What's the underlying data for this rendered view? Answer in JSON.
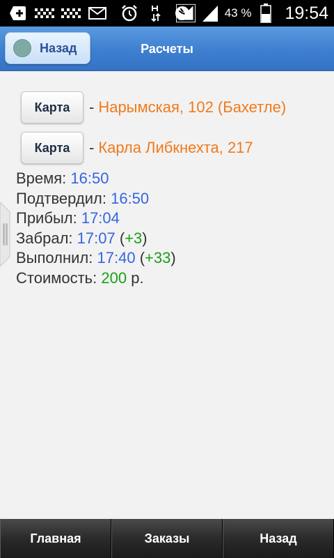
{
  "status_bar": {
    "icons": [
      "add-box-icon",
      "taxi-icon",
      "taxi-icon",
      "mail-icon",
      "alarm-icon",
      "data-arrows-icon",
      "location-icon",
      "signal-icon",
      "signal-icon",
      "battery-icon"
    ],
    "battery_percent": "43 %",
    "time": "19:54"
  },
  "header": {
    "back_label": "Назад",
    "title": "Расчеты",
    "accent": "#3e7fd0"
  },
  "addresses": [
    {
      "button": "Карта",
      "separator": "-",
      "text": "Нарымская, 102 (Бахетле)"
    },
    {
      "button": "Карта",
      "separator": "-",
      "text": "Карла Либкнехта, 217"
    }
  ],
  "info": {
    "time_label": "Время:",
    "time_value": "16:50",
    "confirmed_label": "Подтвердил:",
    "confirmed_value": "16:50",
    "arrived_label": "Прибыл:",
    "arrived_value": "17:04",
    "picked_label": "Забрал:",
    "picked_value": "17:07",
    "picked_delta": "+3",
    "done_label": "Выполнил:",
    "done_value": "17:40",
    "done_delta": "+33",
    "cost_label": "Стоимость:",
    "cost_value": "200",
    "cost_unit": "р."
  },
  "tabs": [
    {
      "label": "Главная"
    },
    {
      "label": "Заказы"
    },
    {
      "label": "Назад"
    }
  ],
  "colors": {
    "address": "#f07a1c",
    "time_value": "#3366e0",
    "delta": "#18a018"
  }
}
